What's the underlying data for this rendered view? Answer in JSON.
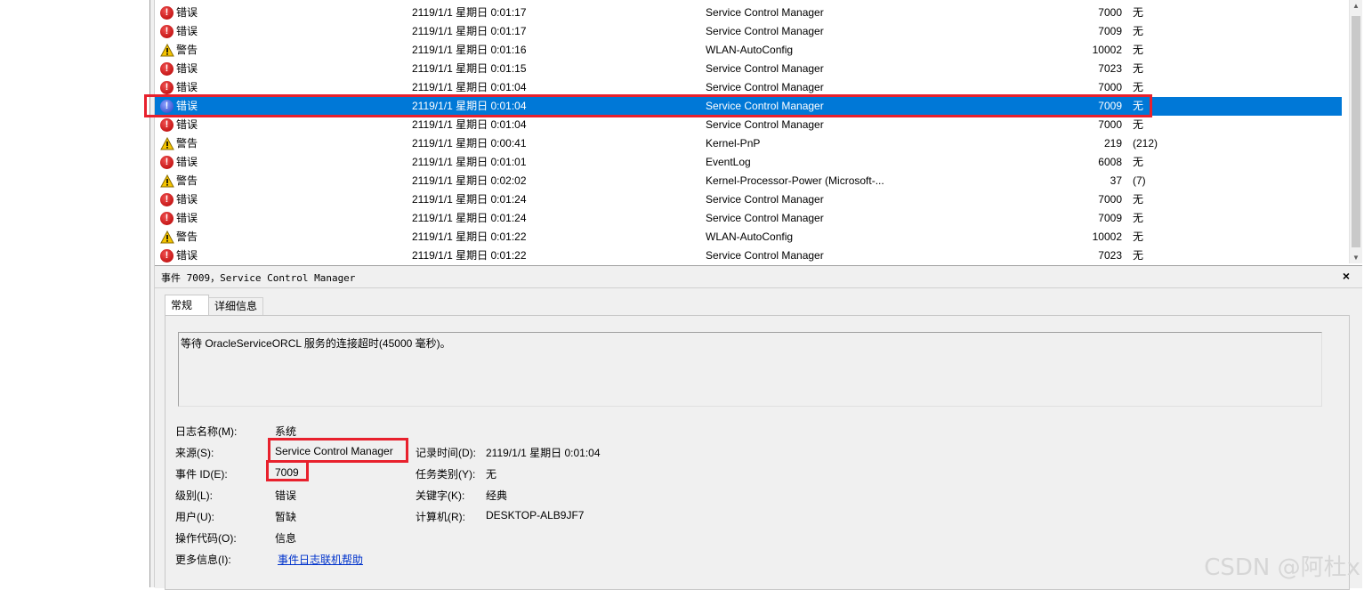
{
  "events": [
    {
      "level": "错误",
      "type": "error",
      "datetime": "2119/1/1 星期日 0:01:17",
      "source": "Service Control Manager",
      "id": "7000",
      "category": "无"
    },
    {
      "level": "错误",
      "type": "error",
      "datetime": "2119/1/1 星期日 0:01:17",
      "source": "Service Control Manager",
      "id": "7009",
      "category": "无"
    },
    {
      "level": "警告",
      "type": "warning",
      "datetime": "2119/1/1 星期日 0:01:16",
      "source": "WLAN-AutoConfig",
      "id": "10002",
      "category": "无"
    },
    {
      "level": "错误",
      "type": "error",
      "datetime": "2119/1/1 星期日 0:01:15",
      "source": "Service Control Manager",
      "id": "7023",
      "category": "无"
    },
    {
      "level": "错误",
      "type": "error",
      "datetime": "2119/1/1 星期日 0:01:04",
      "source": "Service Control Manager",
      "id": "7000",
      "category": "无"
    },
    {
      "level": "错误",
      "type": "error",
      "datetime": "2119/1/1 星期日 0:01:04",
      "source": "Service Control Manager",
      "id": "7009",
      "category": "无",
      "selected": true
    },
    {
      "level": "错误",
      "type": "error",
      "datetime": "2119/1/1 星期日 0:01:04",
      "source": "Service Control Manager",
      "id": "7000",
      "category": "无"
    },
    {
      "level": "警告",
      "type": "warning",
      "datetime": "2119/1/1 星期日 0:00:41",
      "source": "Kernel-PnP",
      "id": "219",
      "category": "(212)"
    },
    {
      "level": "错误",
      "type": "error",
      "datetime": "2119/1/1 星期日 0:01:01",
      "source": "EventLog",
      "id": "6008",
      "category": "无"
    },
    {
      "level": "警告",
      "type": "warning",
      "datetime": "2119/1/1 星期日 0:02:02",
      "source": "Kernel-Processor-Power (Microsoft-...",
      "id": "37",
      "category": "(7)"
    },
    {
      "level": "错误",
      "type": "error",
      "datetime": "2119/1/1 星期日 0:01:24",
      "source": "Service Control Manager",
      "id": "7000",
      "category": "无"
    },
    {
      "level": "错误",
      "type": "error",
      "datetime": "2119/1/1 星期日 0:01:24",
      "source": "Service Control Manager",
      "id": "7009",
      "category": "无"
    },
    {
      "level": "警告",
      "type": "warning",
      "datetime": "2119/1/1 星期日 0:01:22",
      "source": "WLAN-AutoConfig",
      "id": "10002",
      "category": "无"
    },
    {
      "level": "错误",
      "type": "error",
      "datetime": "2119/1/1 星期日 0:01:22",
      "source": "Service Control Manager",
      "id": "7023",
      "category": "无"
    }
  ],
  "detail": {
    "title": "事件 7009，Service Control Manager",
    "close": "×",
    "tabs": [
      "常规",
      "详细信息"
    ],
    "description": "等待 OracleServiceORCL 服务的连接超时(45000 毫秒)。",
    "fields": {
      "log_name_label": "日志名称(M):",
      "log_name": "系统",
      "source_label": "来源(S):",
      "source": "Service Control Manager",
      "logged_label": "记录时间(D):",
      "logged": "2119/1/1 星期日 0:01:04",
      "event_id_label": "事件 ID(E):",
      "event_id": "7009",
      "task_label": "任务类别(Y):",
      "task": "无",
      "level_label": "级别(L):",
      "level": "错误",
      "keywords_label": "关键字(K):",
      "keywords": "经典",
      "user_label": "用户(U):",
      "user": "暂缺",
      "computer_label": "计算机(R):",
      "computer": "DESKTOP-ALB9JF7",
      "opcode_label": "操作代码(O):",
      "opcode": "信息",
      "more_info_label": "更多信息(I):",
      "more_info_link": "事件日志联机帮助"
    }
  },
  "watermark": "CSDN @阿杜x",
  "colors": {
    "selection": "#0078d7",
    "highlight": "#e8212d",
    "error": "#c00000",
    "warning": "#f5c400"
  }
}
